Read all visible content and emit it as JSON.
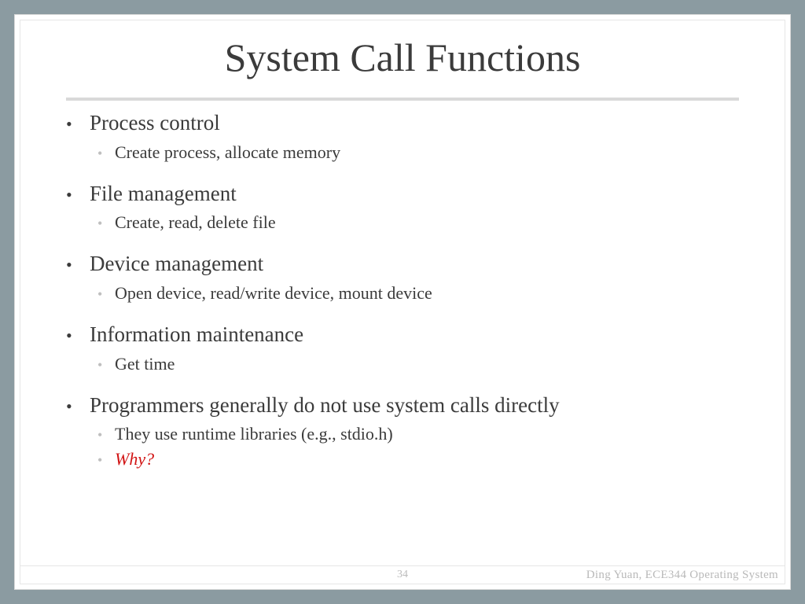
{
  "title": "System Call Functions",
  "bullets": [
    {
      "text": "Process control",
      "subs": [
        {
          "text": "Create process, allocate memory",
          "emph": false
        }
      ]
    },
    {
      "text": "File management",
      "subs": [
        {
          "text": "Create, read, delete file",
          "emph": false
        }
      ]
    },
    {
      "text": "Device management",
      "subs": [
        {
          "text": "Open device, read/write device, mount device",
          "emph": false
        }
      ]
    },
    {
      "text": "Information maintenance",
      "subs": [
        {
          "text": "Get time",
          "emph": false
        }
      ]
    },
    {
      "text": "Programmers generally do not use system calls directly",
      "subs": [
        {
          "text": "They use runtime libraries (e.g., stdio.h)",
          "emph": false
        },
        {
          "text": "Why?",
          "emph": true
        }
      ]
    }
  ],
  "footer": {
    "page_number": "34",
    "course": "Ding Yuan, ECE344 Operating System"
  }
}
